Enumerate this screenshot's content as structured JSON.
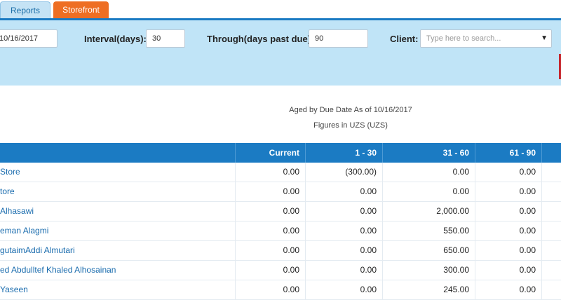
{
  "tabs": [
    {
      "label": "Reports"
    },
    {
      "label": "Storefront"
    }
  ],
  "filters": {
    "date_value": "10/16/2017",
    "interval_label": "Interval(days):",
    "interval_value": "30",
    "through_label": "Through(days past due):",
    "through_value": "90",
    "client_label": "Client:",
    "client_placeholder": "Type here to search...",
    "dropdown_icon": "▼"
  },
  "report": {
    "subtitle": "Aged by Due Date As of 10/16/2017",
    "currency": "Figures in UZS (UZS)"
  },
  "table": {
    "columns": [
      "Current",
      "1 - 30",
      "31 - 60",
      "61 - 90"
    ],
    "rows": [
      {
        "name": "Store",
        "current": "0.00",
        "d1_30": "(300.00)",
        "d31_60": "0.00",
        "d61_90": "0.00"
      },
      {
        "name": "tore",
        "current": "0.00",
        "d1_30": "0.00",
        "d31_60": "0.00",
        "d61_90": "0.00"
      },
      {
        "name": "Alhasawi",
        "current": "0.00",
        "d1_30": "0.00",
        "d31_60": "2,000.00",
        "d61_90": "0.00"
      },
      {
        "name": "eman Alagmi",
        "current": "0.00",
        "d1_30": "0.00",
        "d31_60": "550.00",
        "d61_90": "0.00"
      },
      {
        "name": "gutaimAddi Almutari",
        "current": "0.00",
        "d1_30": "0.00",
        "d31_60": "650.00",
        "d61_90": "0.00"
      },
      {
        "name": "ed Abdulltef Khaled Alhosainan",
        "current": "0.00",
        "d1_30": "0.00",
        "d31_60": "300.00",
        "d61_90": "0.00"
      },
      {
        "name": "Yaseen",
        "current": "0.00",
        "d1_30": "0.00",
        "d31_60": "245.00",
        "d61_90": "0.00"
      }
    ]
  }
}
